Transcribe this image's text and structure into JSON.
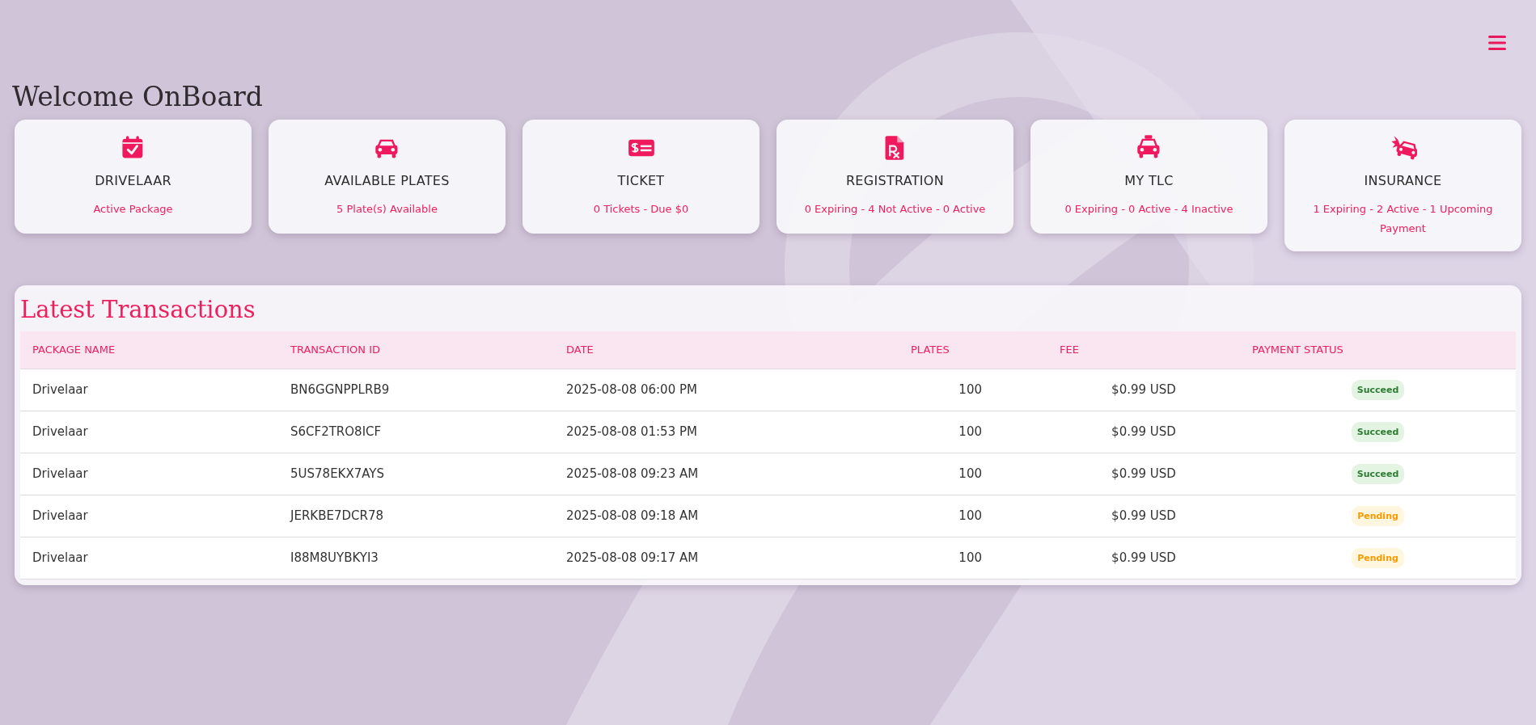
{
  "page": {
    "title": "Welcome OnBoard"
  },
  "cards": [
    {
      "kind": "calendar",
      "title": "DRIVELAAR",
      "subtitle": "Active Package"
    },
    {
      "kind": "car",
      "title": "AVAILABLE PLATES",
      "subtitle": "5 Plate(s) Available"
    },
    {
      "kind": "ticket",
      "title": "TICKET",
      "subtitle": "0 Tickets - Due $0"
    },
    {
      "kind": "document",
      "title": "REGISTRATION",
      "subtitle": "0 Expiring - 4 Not Active - 0 Active"
    },
    {
      "kind": "taxi",
      "title": "MY TLC",
      "subtitle": "0 Expiring - 0 Active - 4 Inactive"
    },
    {
      "kind": "crash",
      "title": "INSURANCE",
      "subtitle": "1 Expiring - 2 Active - 1 Upcoming Payment"
    }
  ],
  "transactions": {
    "title": "Latest Transactions",
    "columns": [
      "PACKAGE NAME",
      "TRANSACTION ID",
      "DATE",
      "PLATES",
      "FEE",
      "PAYMENT STATUS"
    ],
    "rows": [
      {
        "package": "Drivelaar",
        "transaction_id": "BN6GGNPPLRB9",
        "date": "2025-08-08 06:00 PM",
        "plates": "100",
        "fee": "$0.99 USD",
        "status": {
          "label": "Succeed",
          "kind": "success"
        }
      },
      {
        "package": "Drivelaar",
        "transaction_id": "S6CF2TRO8ICF",
        "date": "2025-08-08 01:53 PM",
        "plates": "100",
        "fee": "$0.99 USD",
        "status": {
          "label": "Succeed",
          "kind": "success"
        }
      },
      {
        "package": "Drivelaar",
        "transaction_id": "5US78EKX7AYS",
        "date": "2025-08-08 09:23 AM",
        "plates": "100",
        "fee": "$0.99 USD",
        "status": {
          "label": "Succeed",
          "kind": "success"
        }
      },
      {
        "package": "Drivelaar",
        "transaction_id": "JERKBE7DCR78",
        "date": "2025-08-08 09:18 AM",
        "plates": "100",
        "fee": "$0.99 USD",
        "status": {
          "label": "Pending",
          "kind": "pending"
        }
      },
      {
        "package": "Drivelaar",
        "transaction_id": "I88M8UYBKYI3",
        "date": "2025-08-08 09:17 AM",
        "plates": "100",
        "fee": "$0.99 USD",
        "status": {
          "label": "Pending",
          "kind": "pending"
        }
      }
    ]
  }
}
